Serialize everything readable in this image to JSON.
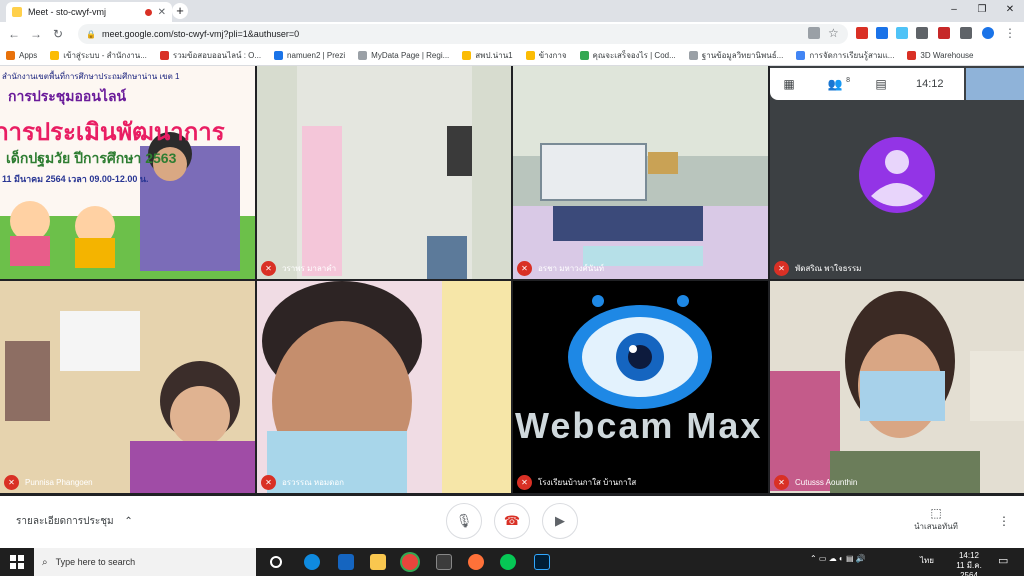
{
  "browser": {
    "tab_title": "Meet - sto-cwyf-vmj",
    "tab_close": "✕",
    "new_tab": "+",
    "url": "meet.google.com/sto-cwyf-vmj?pli=1&authuser=0",
    "window_controls": {
      "minimize": "–",
      "maximize": "❐",
      "close": "✕"
    }
  },
  "bookmarks": [
    {
      "label": "Apps",
      "color": "#e8710a"
    },
    {
      "label": "เข้าสู่ระบบ - สำนักงาน...",
      "color": "#fbbc04"
    },
    {
      "label": "รวมข้อสอบออนไลน์ : O...",
      "color": "#d93025"
    },
    {
      "label": "namuen2 | Prezi",
      "color": "#1a73e8"
    },
    {
      "label": "MyData Page | Regi...",
      "color": "#9aa0a6"
    },
    {
      "label": "สพป.น่าน1",
      "color": "#fbbc04"
    },
    {
      "label": "ข้างกาจ",
      "color": "#fbbc04"
    },
    {
      "label": "คุณจะเสร็จองไร | Cod...",
      "color": "#34a853"
    },
    {
      "label": "ฐานข้อมูลวิทยานิพนธ์...",
      "color": "#9aa0a6"
    },
    {
      "label": "การจัดการเรียนรู้สามแ...",
      "color": "#4285f4"
    },
    {
      "label": "3D Warehouse",
      "color": "#d93025"
    }
  ],
  "meeting": {
    "clock": "14:12",
    "participant_count": "8",
    "slide": {
      "line1": "สำนักงานเขตพื้นที่การศึกษาประถมศึกษาน่าน เขต 1",
      "line2": "การประชุมออนไลน์",
      "line3": "การประเมินพัฒนาการ",
      "line4": "เด็กปฐมวัย ปีการศึกษา 2563",
      "line5": "11 มีนาคม 2564 เวลา 09.00-12.00 น."
    },
    "tiles": [
      {
        "name": "",
        "muted": false
      },
      {
        "name": "วราพร มาลาคำ",
        "muted": true
      },
      {
        "name": "อรชา มหาวงศ์นันท์",
        "muted": true
      },
      {
        "name": "พัดสริณ พาใจธรรม",
        "muted": true,
        "initial_avatar_color": "#9334e6"
      },
      {
        "name": "Punnisa Phangoen",
        "muted": true
      },
      {
        "name": "อรวรรณ หอมดอก",
        "muted": true
      },
      {
        "name": "โรงเรียนบ้านกาใส บ้านกาใส",
        "muted": true,
        "overlay_text": "Webcam Max"
      },
      {
        "name": "Cutusss Aounthin",
        "muted": true
      }
    ],
    "controls": {
      "details_label": "รายละเอียดการประชุม",
      "present_label": "นำเสนอทันที"
    }
  },
  "taskbar": {
    "search_placeholder": "Type here to search",
    "lang": "ไทย",
    "time": "14:12",
    "date": "11 มี.ค. 2564"
  }
}
